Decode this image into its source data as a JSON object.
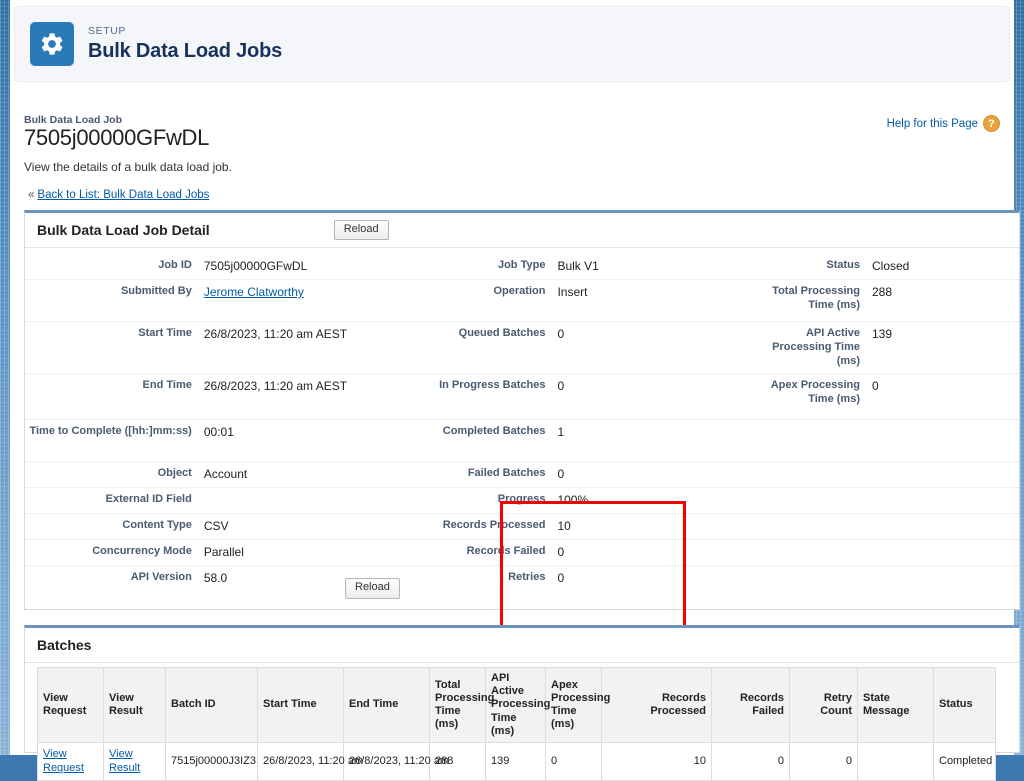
{
  "setup_header": {
    "icon": "gear-icon",
    "eyebrow": "SETUP",
    "title": "Bulk Data Load Jobs"
  },
  "record": {
    "eyebrow": "Bulk Data Load Job",
    "title": "7505j00000GFwDL",
    "description": "View the details of a bulk data load job.",
    "back_chevron": "«",
    "back_link": "Back to List: Bulk Data Load Jobs",
    "help_link": "Help for this Page",
    "help_icon": "question-mark-icon"
  },
  "detail_panel": {
    "title": "Bulk Data Load Job Detail",
    "reload_top_label": "Reload",
    "reload_bottom_label": "Reload",
    "rows": [
      {
        "left_label": "Job ID",
        "left_value": "7505j00000GFwDL",
        "mid_label": "Job Type",
        "mid_value": "Bulk V1",
        "right_label": "Status",
        "right_value": "Closed"
      },
      {
        "left_label": "Submitted By",
        "left_value": "Jerome Clatworthy",
        "left_is_link": true,
        "mid_label": "Operation",
        "mid_value": "Insert",
        "right_label": "Total Processing Time (ms)",
        "right_value": "288"
      },
      {
        "left_label": "Start Time",
        "left_value": "26/8/2023, 11:20 am AEST",
        "mid_label": "Queued Batches",
        "mid_value": "0",
        "right_label": "API Active Processing Time (ms)",
        "right_value": "139"
      },
      {
        "left_label": "End Time",
        "left_value": "26/8/2023, 11:20 am AEST",
        "mid_label": "In Progress Batches",
        "mid_value": "0",
        "right_label": "Apex Processing Time (ms)",
        "right_value": "0"
      },
      {
        "left_label": "Time to Complete ([hh:]mm:ss)",
        "left_value": "00:01",
        "mid_label": "Completed Batches",
        "mid_value": "1",
        "right_label": "",
        "right_value": ""
      },
      {
        "left_label": "Object",
        "left_value": "Account",
        "mid_label": "Failed Batches",
        "mid_value": "0",
        "right_label": "",
        "right_value": ""
      },
      {
        "left_label": "External ID Field",
        "left_value": "",
        "mid_label": "Progress",
        "mid_value": "100%",
        "right_label": "",
        "right_value": ""
      },
      {
        "left_label": "Content Type",
        "left_value": "CSV",
        "mid_label": "Records Processed",
        "mid_value": "10",
        "right_label": "",
        "right_value": ""
      },
      {
        "left_label": "Concurrency Mode",
        "left_value": "Parallel",
        "mid_label": "Records Failed",
        "mid_value": "0",
        "right_label": "",
        "right_value": ""
      },
      {
        "left_label": "API Version",
        "left_value": "58.0",
        "mid_label": "Retries",
        "mid_value": "0",
        "right_label": "",
        "right_value": ""
      }
    ],
    "highlight": {
      "color": "#f40000",
      "covers": [
        "Completed Batches",
        "Failed Batches",
        "Progress",
        "Records Processed",
        "Records Failed",
        "Retries"
      ]
    }
  },
  "batches_panel": {
    "title": "Batches",
    "columns": [
      "View Request",
      "View Result",
      "Batch ID",
      "Start Time",
      "End Time",
      "Total Processing Time (ms)",
      "API Active Processing Time (ms)",
      "Apex Processing Time (ms)",
      "Records Processed",
      "Records Failed",
      "Retry Count",
      "State Message",
      "Status"
    ],
    "rows": [
      {
        "view_request": "View Request",
        "view_result": "View Result",
        "batch_id": "7515j00000J3IZ3",
        "start_time": "26/8/2023, 11:20 am",
        "end_time": "26/8/2023, 11:20 am",
        "total_processing_time": "288",
        "api_active_processing_time": "139",
        "apex_processing_time": "0",
        "records_processed": "10",
        "records_failed": "0",
        "retry_count": "0",
        "state_message": "",
        "status": "Completed"
      }
    ]
  },
  "colors": {
    "brand_blue": "#2b7ab8",
    "link_blue": "#015ba7",
    "panel_top_border": "#6b94bb",
    "highlight_red": "#f40000",
    "help_orange": "#e8a33d"
  }
}
